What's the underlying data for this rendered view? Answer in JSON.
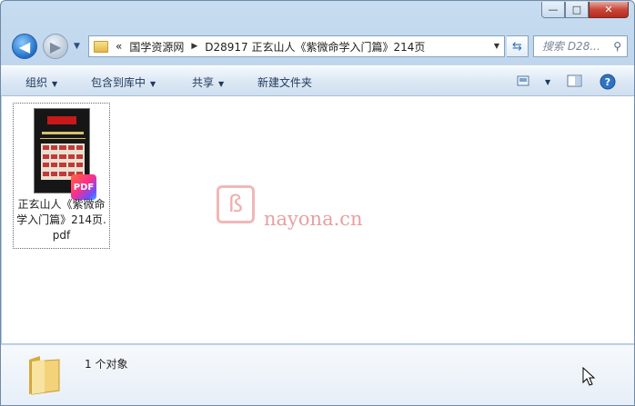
{
  "titlebar": {
    "min_glyph": "—",
    "max_glyph": "□",
    "close_glyph": "✕"
  },
  "address": {
    "overflow": "«",
    "segments": [
      "国学资源网",
      "D28917 正玄山人《紫微命学入门篇》214页"
    ]
  },
  "search": {
    "placeholder": "搜索 D28...",
    "icon": "search-icon"
  },
  "toolbar": {
    "organize": "组织",
    "include_in_library": "包含到库中",
    "share": "共享",
    "new_folder": "新建文件夹",
    "view_icon": "view-icon",
    "preview_pane_icon": "preview-pane-icon",
    "help_icon": "help-icon"
  },
  "files": [
    {
      "name": "正玄山人《紫微命学入门篇》214页.pdf",
      "badge": "PDF"
    }
  ],
  "watermark": {
    "site": "nayona.cn"
  },
  "details": {
    "count": "1 个对象"
  },
  "colors": {
    "accent": "#1f6fc8",
    "close": "#c7473a",
    "watermark": "#e8a0a0"
  }
}
